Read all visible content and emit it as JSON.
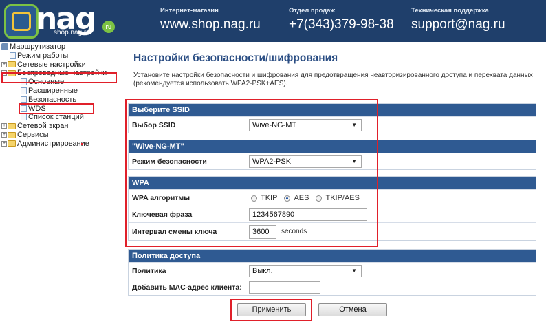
{
  "header": {
    "logo_word": "nag",
    "logo_sub": "shop.nag.ru",
    "logo_badge": "ru",
    "columns": [
      {
        "caption": "Интернет-магазин",
        "value": "www.shop.nag.ru"
      },
      {
        "caption": "Отдел продаж",
        "value": "+7(343)379-98-38"
      },
      {
        "caption": "Техническая поддержка",
        "value": "support@nag.ru"
      }
    ]
  },
  "tree": {
    "root": "Маршрутизатор",
    "items": [
      "Режим работы",
      "Сетевые настройки",
      "Беспроводные настройки",
      "Основные",
      "Расширенные",
      "Безопасность",
      "WDS",
      "Список станций",
      "Сетевой экран",
      "Сервисы",
      "Администрирование"
    ]
  },
  "page": {
    "title": "Настройки безопасности/шифрования",
    "description": "Установите настройки безопасности и шифрования для предотвращения неавторизированного доступа и перехвата данных (рекомендуется использовать WPA2-PSK+AES)."
  },
  "ssid_section": {
    "header": "Выберите SSID",
    "label": "Выбор SSID",
    "value": "Wive-NG-MT"
  },
  "security_section": {
    "header": "\"Wive-NG-MT\"",
    "label": "Режим безопасности",
    "value": "WPA2-PSK"
  },
  "wpa_section": {
    "header": "WPA",
    "alg_label": "WPA алгоритмы",
    "alg_options": [
      "TKIP",
      "AES",
      "TKIP/AES"
    ],
    "alg_selected": "AES",
    "passphrase_label": "Ключевая фраза",
    "passphrase_value": "1234567890",
    "interval_label": "Интервал смены ключа",
    "interval_value": "3600",
    "interval_unit": "seconds"
  },
  "access_section": {
    "header": "Политика доступа",
    "policy_label": "Политика",
    "policy_value": "Выкл.",
    "mac_label": "Добавить MAC-адрес клиента:",
    "mac_value": ""
  },
  "buttons": {
    "apply": "Применить",
    "cancel": "Отмена"
  },
  "colors": {
    "header_bg": "#1f3f6b",
    "section_header": "#2f5a92",
    "title": "#2a4d83",
    "highlight": "#e0202a"
  }
}
